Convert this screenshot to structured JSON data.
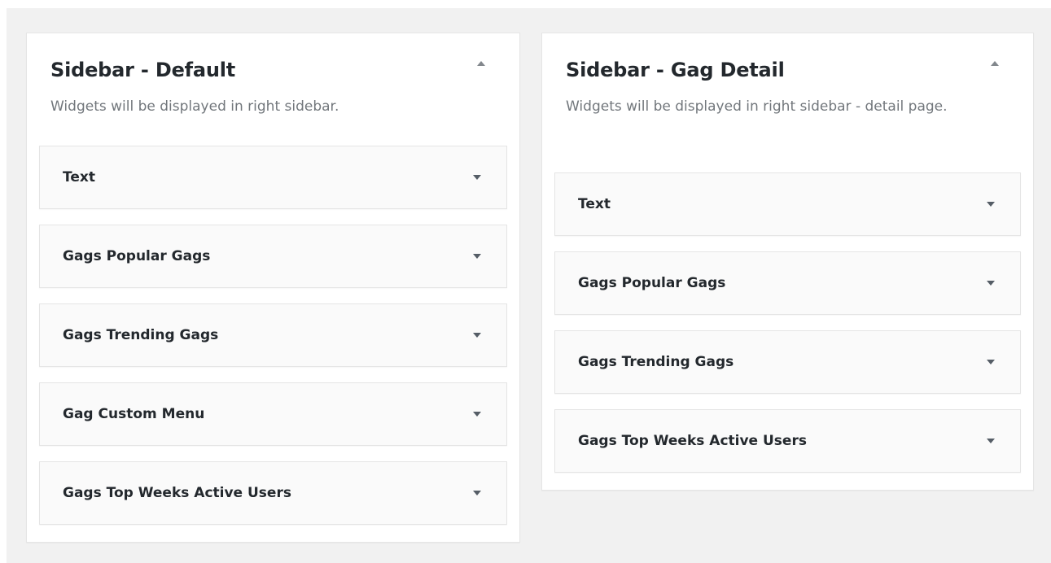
{
  "sidebars": [
    {
      "title": "Sidebar - Default",
      "description": "Widgets will be displayed in right sidebar.",
      "widgets": [
        {
          "label": "Text"
        },
        {
          "label": "Gags Popular Gags"
        },
        {
          "label": "Gags Trending Gags"
        },
        {
          "label": "Gag Custom Menu"
        },
        {
          "label": "Gags Top Weeks Active Users"
        }
      ]
    },
    {
      "title": "Sidebar - Gag Detail",
      "description": "Widgets will be displayed in right sidebar - detail page.",
      "widgets": [
        {
          "label": "Text"
        },
        {
          "label": "Gags Popular Gags"
        },
        {
          "label": "Gags Trending Gags"
        },
        {
          "label": "Gags Top Weeks Active Users"
        }
      ]
    }
  ],
  "icons": {
    "collapse": "arrow-up-icon",
    "expand": "arrow-down-icon"
  },
  "colors": {
    "background": "#f1f1f1",
    "panel": "#ffffff",
    "widget": "#fafafa",
    "border": "#e5e5e5",
    "text": "#23282d",
    "muted_text": "#72777c",
    "icon": "#82878c"
  }
}
